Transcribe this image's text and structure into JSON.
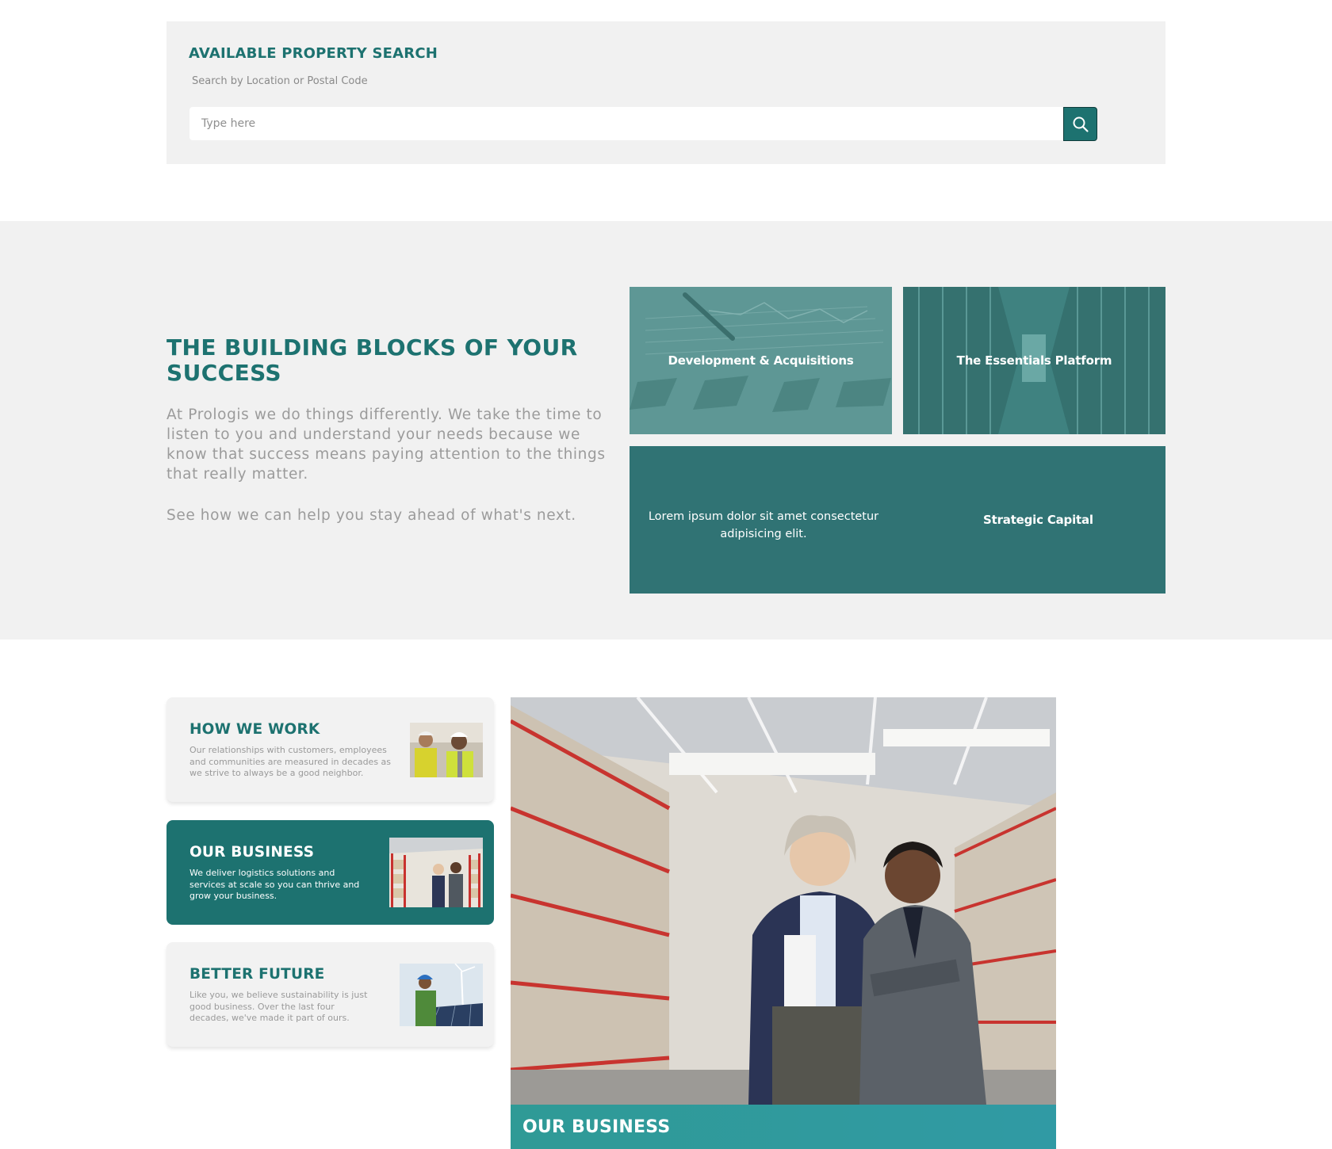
{
  "search": {
    "title": "AVAILABLE PROPERTY SEARCH",
    "subtitle": "Search by Location or Postal Code",
    "placeholder": "Type here",
    "button_icon": "search-icon"
  },
  "blocks": {
    "title": "THE BUILDING BLOCKS OF YOUR SUCCESS",
    "paragraph": "At Prologis we do things differently. We take the time to listen to you and understand your needs because we know that success means paying attention to the things that really matter.",
    "paragraph2": "See how we can help you stay ahead of what's next.",
    "tiles": [
      {
        "label": "Development & Acquisitions"
      },
      {
        "label": "The Essentials Platform"
      },
      {
        "text": "Lorem ipsum dolor sit amet consectetur adipisicing elit.",
        "label": "Strategic Capital"
      }
    ]
  },
  "cards": [
    {
      "title": "HOW WE WORK",
      "text": "Our relationships with customers, employees and communities are measured in decades as we strive to always be a good neighbor."
    },
    {
      "title": "OUR BUSINESS",
      "text": "We deliver logistics solutions and services at scale so you can thrive and grow your business."
    },
    {
      "title": "BETTER FUTURE",
      "text": "Like you, we believe sustainability is just good business. Over the last four decades, we've made it part of ours."
    }
  ],
  "hero": {
    "caption": "OUR BUSINESS"
  },
  "colors": {
    "brand": "#1d7270",
    "accent": "#309a9c",
    "panel": "#f1f1f1"
  }
}
